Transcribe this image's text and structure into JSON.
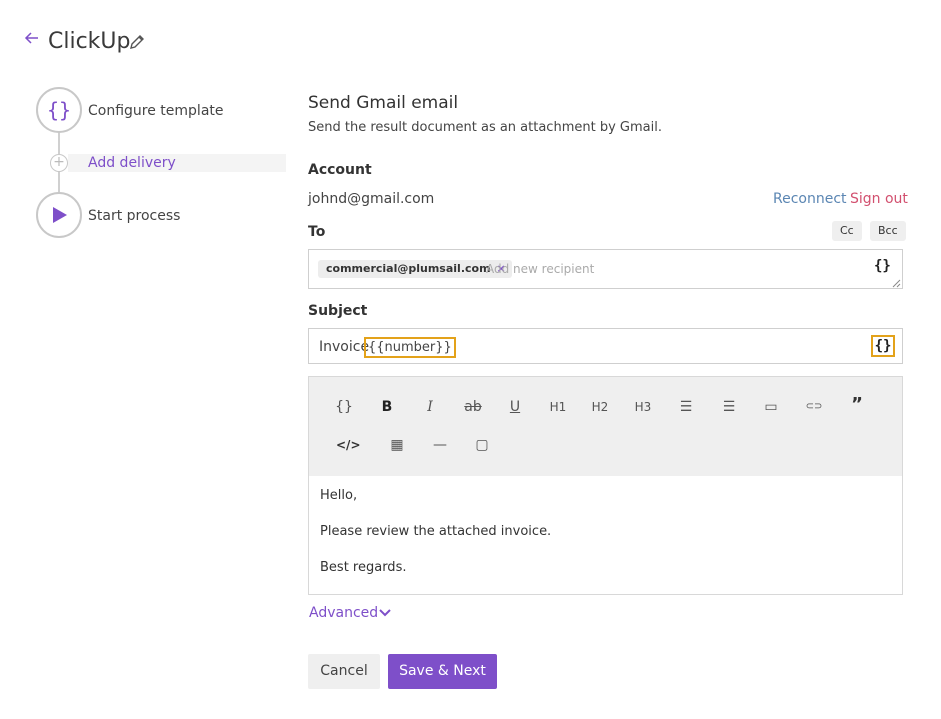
{
  "header": {
    "back_icon": "back-arrow-icon",
    "title": "ClickUp",
    "edit_icon": "pencil-icon"
  },
  "steps": [
    {
      "label": "Configure template",
      "icon": "braces-icon",
      "glyph": "{}"
    },
    {
      "label": "Add delivery",
      "icon": "plus-icon",
      "glyph": "+"
    },
    {
      "label": "Start process",
      "icon": "play-icon"
    }
  ],
  "form": {
    "title": "Send Gmail email",
    "subtitle": "Send the result document as an attachment by Gmail.",
    "account": {
      "label": "Account",
      "email": "johnd@gmail.com",
      "reconnect": "Reconnect",
      "sign_out": "Sign out"
    },
    "to": {
      "label": "To",
      "cc": "Cc",
      "bcc": "Bcc",
      "recipients": [
        {
          "email": "commercial@plumsail.com",
          "remove": "×"
        }
      ],
      "placeholder": "Add new recipient",
      "braces": "{}"
    },
    "subject": {
      "label": "Subject",
      "text": "Invoice",
      "token": "{{number}}",
      "braces": "{}"
    },
    "editor": {
      "toolbar_row1": [
        {
          "name": "insert-token-icon",
          "glyph": "{}"
        },
        {
          "name": "bold-icon",
          "glyph": "B"
        },
        {
          "name": "italic-icon",
          "glyph": "I"
        },
        {
          "name": "strikethrough-icon",
          "glyph": "ab"
        },
        {
          "name": "underline-icon",
          "glyph": "U"
        },
        {
          "name": "heading1-icon",
          "glyph": "H1"
        },
        {
          "name": "heading2-icon",
          "glyph": "H2"
        },
        {
          "name": "heading3-icon",
          "glyph": "H3"
        },
        {
          "name": "bullet-list-icon",
          "glyph": "☰"
        },
        {
          "name": "numbered-list-icon",
          "glyph": "☰"
        },
        {
          "name": "image-icon",
          "glyph": "▭"
        },
        {
          "name": "link-icon",
          "glyph": "⊂⊃"
        },
        {
          "name": "quote-icon",
          "glyph": "”"
        }
      ],
      "toolbar_row2": [
        {
          "name": "code-icon",
          "glyph": "</>"
        },
        {
          "name": "table-icon",
          "glyph": "▦"
        },
        {
          "name": "horizontal-rule-icon",
          "glyph": "—"
        },
        {
          "name": "source-code-icon",
          "glyph": "▢"
        }
      ],
      "body": [
        "Hello,",
        "Please review the attached invoice.",
        "Best regards."
      ]
    },
    "advanced": {
      "label": "Advanced",
      "icon": "chevron-down-icon"
    },
    "buttons": {
      "cancel": "Cancel",
      "save": "Save & Next"
    }
  },
  "colors": {
    "accent": "#7e4fc9",
    "highlight": "#e3a21a",
    "link": "#5b86b3",
    "danger": "#d2506f"
  }
}
